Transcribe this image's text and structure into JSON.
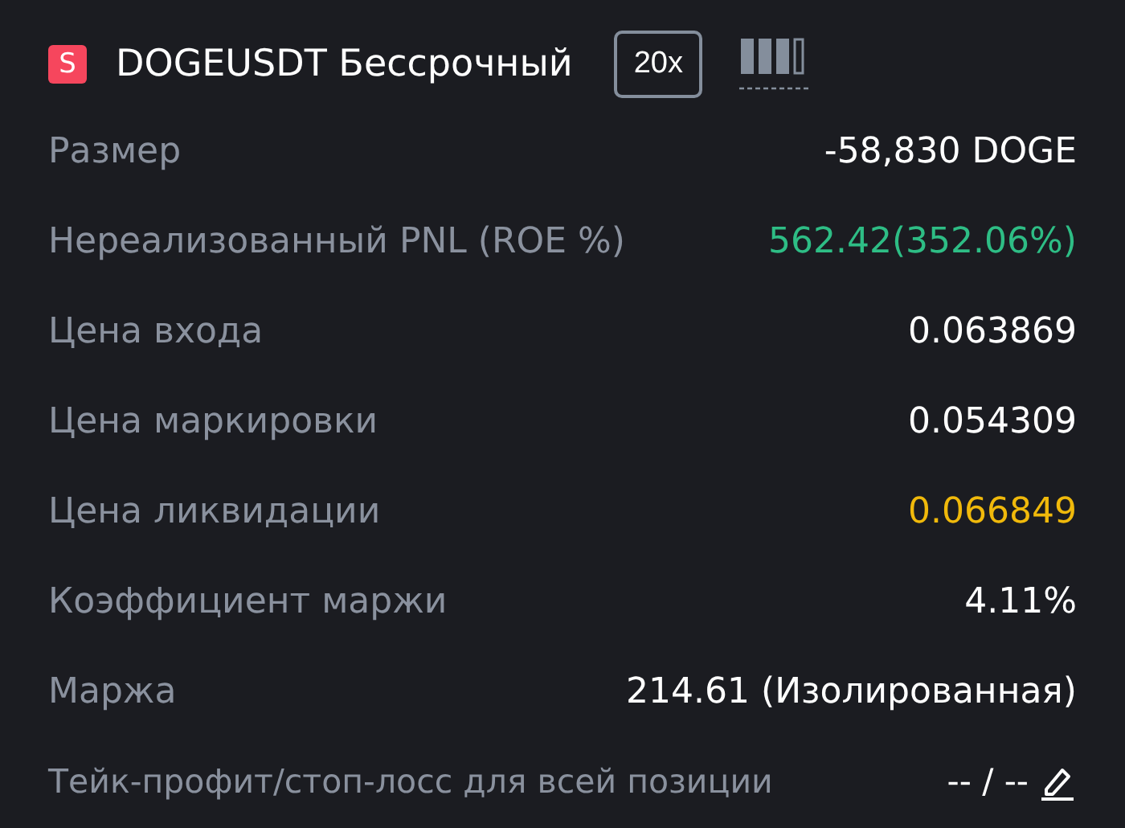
{
  "header": {
    "side_badge": "S",
    "symbol": "DOGEUSDT Бессрочный",
    "leverage": "20x"
  },
  "rows": [
    {
      "label": "Размер",
      "value": "-58,830 DOGE",
      "color": "#ffffff"
    },
    {
      "label": "Нереализованный PNL (ROE %)",
      "value": "562.42(352.06%)",
      "color": "#2ebd85"
    },
    {
      "label": "Цена входа",
      "value": "0.063869",
      "color": "#ffffff"
    },
    {
      "label": "Цена маркировки",
      "value": "0.054309",
      "color": "#ffffff"
    },
    {
      "label": "Цена ликвидации",
      "value": "0.066849",
      "color": "#f0b90b"
    },
    {
      "label": "Коэффициент маржи",
      "value": "4.11%",
      "color": "#ffffff"
    },
    {
      "label": "Маржа",
      "value": "214.61 (Изолированная)",
      "color": "#ffffff"
    }
  ],
  "tpsl": {
    "label": "Тейк-профит/стоп-лосс для всей позиции",
    "value": "-- / --"
  }
}
